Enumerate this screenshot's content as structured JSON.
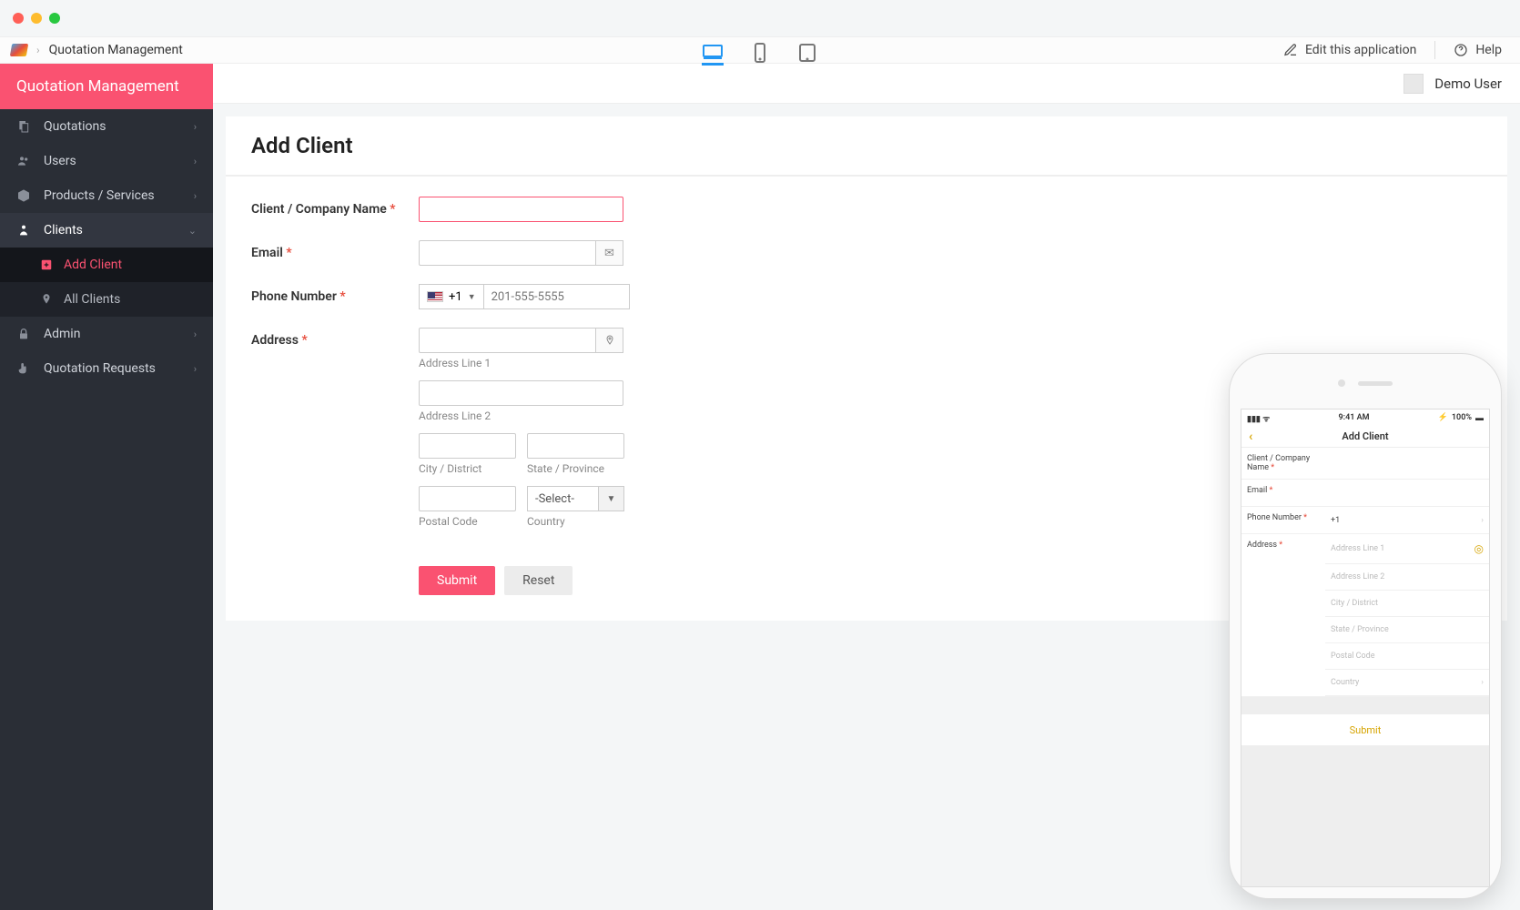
{
  "breadcrumb": {
    "app": "Quotation Management"
  },
  "topbar": {
    "edit": "Edit this application",
    "help": "Help"
  },
  "sidebar": {
    "brand": "Quotation Management",
    "items": [
      {
        "label": "Quotations"
      },
      {
        "label": "Users"
      },
      {
        "label": "Products / Services"
      },
      {
        "label": "Clients"
      },
      {
        "label": "Admin"
      },
      {
        "label": "Quotation Requests"
      }
    ],
    "clientSub": [
      {
        "label": "Add Client"
      },
      {
        "label": "All Clients"
      }
    ]
  },
  "user": {
    "name": "Demo User"
  },
  "page": {
    "title": "Add Client"
  },
  "form": {
    "clientName": {
      "label": "Client / Company Name"
    },
    "email": {
      "label": "Email"
    },
    "phone": {
      "label": "Phone Number",
      "prefix": "+1",
      "placeholder": "201-555-5555"
    },
    "address": {
      "label": "Address",
      "line1": "Address Line 1",
      "line2": "Address Line 2",
      "city": "City / District",
      "state": "State / Province",
      "postal": "Postal Code",
      "country": "Country",
      "countrySelect": "-Select-"
    },
    "submit": "Submit",
    "reset": "Reset"
  },
  "mobile": {
    "time": "9:41 AM",
    "battery": "100%",
    "title": "Add Client",
    "labels": {
      "clientName": "Client / Company Name",
      "email": "Email",
      "phone": "Phone Number",
      "phonePrefix": "+1",
      "address": "Address",
      "line1": "Address Line 1",
      "line2": "Address Line 2",
      "city": "City / District",
      "state": "State / Province",
      "postal": "Postal Code",
      "country": "Country"
    },
    "submit": "Submit"
  }
}
